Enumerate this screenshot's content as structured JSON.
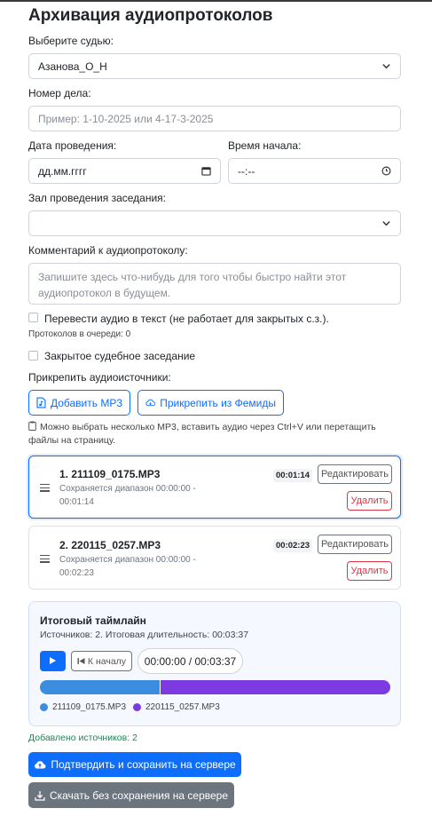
{
  "title": "Архивация аудиопротоколов",
  "judge": {
    "label": "Выберите судью:",
    "value": "Азанова_О_Н"
  },
  "case_number": {
    "label": "Номер дела:",
    "placeholder": "Пример: 1-10-2025 или 4-17-3-2025"
  },
  "date": {
    "label": "Дата проведения:",
    "value": "дд.мм.гггг"
  },
  "time": {
    "label": "Время начала:",
    "value": "--:--"
  },
  "hall": {
    "label": "Зал проведения заседания:",
    "value": ""
  },
  "comment": {
    "label": "Комментарий к аудиопротоколу:",
    "placeholder": "Запишите здесь что-нибудь для того чтобы быстро найти этот аудиопротокол в будущем."
  },
  "transcribe": {
    "label": "Перевести аудио в текст (не работает для закрытых с.з.).",
    "queue": "Протоколов в очереди: 0",
    "checked": false
  },
  "closed": {
    "label": "Закрытое судебное заседание",
    "checked": false
  },
  "attach": {
    "label": "Прикрепить аудиоисточники:",
    "add_mp3": "Добавить MP3",
    "from_femida": "Прикрепить из Фемиды",
    "hint": "Можно выбрать несколько MP3, вставить аудио через Ctrl+V или перетащить файлы на страницу."
  },
  "sources": [
    {
      "name": "1. 211109_0175.MP3",
      "range": "Сохраняется диапазон 00:00:00 - 00:01:14",
      "duration": "00:01:14",
      "edit": "Редактировать",
      "delete": "Удалить"
    },
    {
      "name": "2. 220115_0257.MP3",
      "range": "Сохраняется диапазон 00:00:00 - 00:02:23",
      "duration": "00:02:23",
      "edit": "Редактировать",
      "delete": "Удалить"
    }
  ],
  "timeline": {
    "title": "Итоговый таймлайн",
    "subtitle": "Источников: 2. Итоговая длительность: 00:03:37",
    "to_start": "К началу",
    "time": "00:00:00 / 00:03:37",
    "segments": [
      {
        "name": "211109_0175.MP3",
        "seconds": 74,
        "color": "#3b8de0"
      },
      {
        "name": "220115_0257.MP3",
        "seconds": 143,
        "color": "#7b3be0"
      }
    ]
  },
  "added": "Добавлено источников: 2",
  "save_button": "Подтвердить и сохранить на сервере",
  "download_button": "Скачать без сохранения на сервере"
}
